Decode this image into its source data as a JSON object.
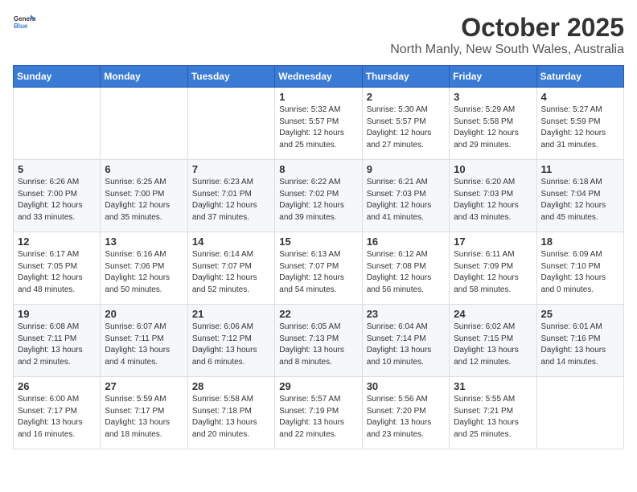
{
  "header": {
    "logo_general": "General",
    "logo_blue": "Blue",
    "month": "October 2025",
    "location": "North Manly, New South Wales, Australia"
  },
  "weekdays": [
    "Sunday",
    "Monday",
    "Tuesday",
    "Wednesday",
    "Thursday",
    "Friday",
    "Saturday"
  ],
  "weeks": [
    [
      {
        "day": "",
        "info": ""
      },
      {
        "day": "",
        "info": ""
      },
      {
        "day": "",
        "info": ""
      },
      {
        "day": "1",
        "info": "Sunrise: 5:32 AM\nSunset: 5:57 PM\nDaylight: 12 hours\nand 25 minutes."
      },
      {
        "day": "2",
        "info": "Sunrise: 5:30 AM\nSunset: 5:57 PM\nDaylight: 12 hours\nand 27 minutes."
      },
      {
        "day": "3",
        "info": "Sunrise: 5:29 AM\nSunset: 5:58 PM\nDaylight: 12 hours\nand 29 minutes."
      },
      {
        "day": "4",
        "info": "Sunrise: 5:27 AM\nSunset: 5:59 PM\nDaylight: 12 hours\nand 31 minutes."
      }
    ],
    [
      {
        "day": "5",
        "info": "Sunrise: 6:26 AM\nSunset: 7:00 PM\nDaylight: 12 hours\nand 33 minutes."
      },
      {
        "day": "6",
        "info": "Sunrise: 6:25 AM\nSunset: 7:00 PM\nDaylight: 12 hours\nand 35 minutes."
      },
      {
        "day": "7",
        "info": "Sunrise: 6:23 AM\nSunset: 7:01 PM\nDaylight: 12 hours\nand 37 minutes."
      },
      {
        "day": "8",
        "info": "Sunrise: 6:22 AM\nSunset: 7:02 PM\nDaylight: 12 hours\nand 39 minutes."
      },
      {
        "day": "9",
        "info": "Sunrise: 6:21 AM\nSunset: 7:03 PM\nDaylight: 12 hours\nand 41 minutes."
      },
      {
        "day": "10",
        "info": "Sunrise: 6:20 AM\nSunset: 7:03 PM\nDaylight: 12 hours\nand 43 minutes."
      },
      {
        "day": "11",
        "info": "Sunrise: 6:18 AM\nSunset: 7:04 PM\nDaylight: 12 hours\nand 45 minutes."
      }
    ],
    [
      {
        "day": "12",
        "info": "Sunrise: 6:17 AM\nSunset: 7:05 PM\nDaylight: 12 hours\nand 48 minutes."
      },
      {
        "day": "13",
        "info": "Sunrise: 6:16 AM\nSunset: 7:06 PM\nDaylight: 12 hours\nand 50 minutes."
      },
      {
        "day": "14",
        "info": "Sunrise: 6:14 AM\nSunset: 7:07 PM\nDaylight: 12 hours\nand 52 minutes."
      },
      {
        "day": "15",
        "info": "Sunrise: 6:13 AM\nSunset: 7:07 PM\nDaylight: 12 hours\nand 54 minutes."
      },
      {
        "day": "16",
        "info": "Sunrise: 6:12 AM\nSunset: 7:08 PM\nDaylight: 12 hours\nand 56 minutes."
      },
      {
        "day": "17",
        "info": "Sunrise: 6:11 AM\nSunset: 7:09 PM\nDaylight: 12 hours\nand 58 minutes."
      },
      {
        "day": "18",
        "info": "Sunrise: 6:09 AM\nSunset: 7:10 PM\nDaylight: 13 hours\nand 0 minutes."
      }
    ],
    [
      {
        "day": "19",
        "info": "Sunrise: 6:08 AM\nSunset: 7:11 PM\nDaylight: 13 hours\nand 2 minutes."
      },
      {
        "day": "20",
        "info": "Sunrise: 6:07 AM\nSunset: 7:11 PM\nDaylight: 13 hours\nand 4 minutes."
      },
      {
        "day": "21",
        "info": "Sunrise: 6:06 AM\nSunset: 7:12 PM\nDaylight: 13 hours\nand 6 minutes."
      },
      {
        "day": "22",
        "info": "Sunrise: 6:05 AM\nSunset: 7:13 PM\nDaylight: 13 hours\nand 8 minutes."
      },
      {
        "day": "23",
        "info": "Sunrise: 6:04 AM\nSunset: 7:14 PM\nDaylight: 13 hours\nand 10 minutes."
      },
      {
        "day": "24",
        "info": "Sunrise: 6:02 AM\nSunset: 7:15 PM\nDaylight: 13 hours\nand 12 minutes."
      },
      {
        "day": "25",
        "info": "Sunrise: 6:01 AM\nSunset: 7:16 PM\nDaylight: 13 hours\nand 14 minutes."
      }
    ],
    [
      {
        "day": "26",
        "info": "Sunrise: 6:00 AM\nSunset: 7:17 PM\nDaylight: 13 hours\nand 16 minutes."
      },
      {
        "day": "27",
        "info": "Sunrise: 5:59 AM\nSunset: 7:17 PM\nDaylight: 13 hours\nand 18 minutes."
      },
      {
        "day": "28",
        "info": "Sunrise: 5:58 AM\nSunset: 7:18 PM\nDaylight: 13 hours\nand 20 minutes."
      },
      {
        "day": "29",
        "info": "Sunrise: 5:57 AM\nSunset: 7:19 PM\nDaylight: 13 hours\nand 22 minutes."
      },
      {
        "day": "30",
        "info": "Sunrise: 5:56 AM\nSunset: 7:20 PM\nDaylight: 13 hours\nand 23 minutes."
      },
      {
        "day": "31",
        "info": "Sunrise: 5:55 AM\nSunset: 7:21 PM\nDaylight: 13 hours\nand 25 minutes."
      },
      {
        "day": "",
        "info": ""
      }
    ]
  ]
}
